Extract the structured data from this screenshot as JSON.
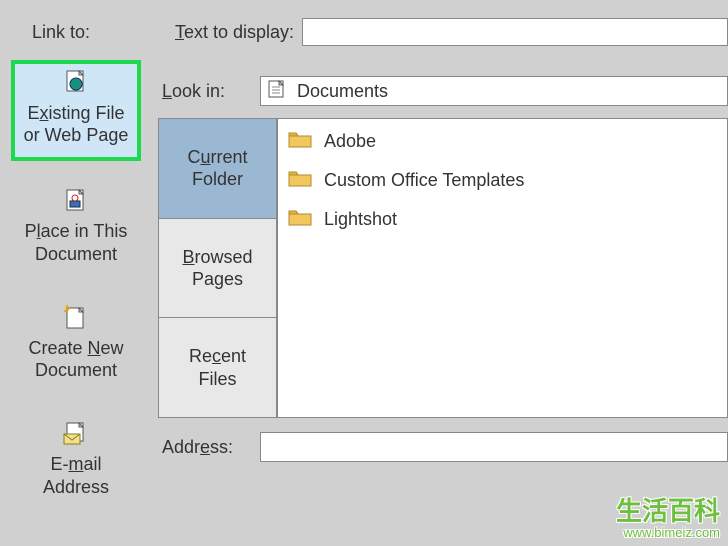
{
  "labels": {
    "link_to": "Link to:",
    "text_to_display": "Text to display:",
    "look_in": "Look in:",
    "address": "Address:"
  },
  "text_display_value": "",
  "address_value": "",
  "lookin_value": "Documents",
  "link_to_options": [
    {
      "line1": "Existing File",
      "line2": "or Web Page",
      "hotkey": "x",
      "selected": true
    },
    {
      "line1": "Place in This",
      "line2": "Document",
      "hotkey": "l",
      "selected": false
    },
    {
      "line1": "Create New",
      "line2": "Document",
      "hotkey": "N",
      "selected": false
    },
    {
      "line1": "E-mail",
      "line2": "Address",
      "hotkey": "m",
      "selected": false
    }
  ],
  "nav_tabs": [
    {
      "line1": "Current",
      "line2": "Folder",
      "hotkey": "u",
      "active": true
    },
    {
      "line1": "Browsed",
      "line2": "Pages",
      "hotkey": "B",
      "active": false
    },
    {
      "line1": "Recent",
      "line2": "Files",
      "hotkey": "c",
      "active": false
    }
  ],
  "file_list": [
    {
      "name": "Adobe",
      "type": "folder"
    },
    {
      "name": "Custom Office Templates",
      "type": "folder"
    },
    {
      "name": "Lightshot",
      "type": "folder"
    }
  ],
  "watermark": {
    "cn": "生活百科",
    "url": "www.bimeiz.com"
  }
}
